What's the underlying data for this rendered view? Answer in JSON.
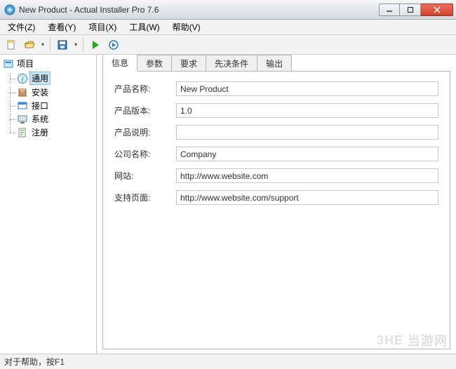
{
  "window": {
    "title": "New Product - Actual Installer Pro 7.6"
  },
  "menu": {
    "file": "文件(Z)",
    "view": "查看(Y)",
    "project": "项目(X)",
    "tools": "工具(W)",
    "help": "帮助(V)"
  },
  "sidebar": {
    "root": "项目",
    "items": [
      {
        "label": "通用",
        "icon": "info-icon",
        "selected": true
      },
      {
        "label": "安装",
        "icon": "install-icon"
      },
      {
        "label": "接口",
        "icon": "interface-icon"
      },
      {
        "label": "系统",
        "icon": "system-icon"
      },
      {
        "label": "注册",
        "icon": "register-icon"
      }
    ]
  },
  "tabs": {
    "info": "信息",
    "params": "参数",
    "requirements": "要求",
    "prerequisites": "先决条件",
    "output": "输出"
  },
  "form": {
    "product_name_label": "产品名称:",
    "product_name": "New Product",
    "product_version_label": "产品版本:",
    "product_version": "1.0",
    "product_description_label": "产品说明:",
    "product_description": "",
    "company_name_label": "公司名称:",
    "company_name": "Company",
    "website_label": "网站:",
    "website": "http://www.website.com",
    "support_page_label": "支持页面:",
    "support_page": "http://www.website.com/support"
  },
  "status": {
    "text": "对于帮助，按F1"
  },
  "watermark": {
    "brand": "3HE",
    "text": "当游网"
  }
}
